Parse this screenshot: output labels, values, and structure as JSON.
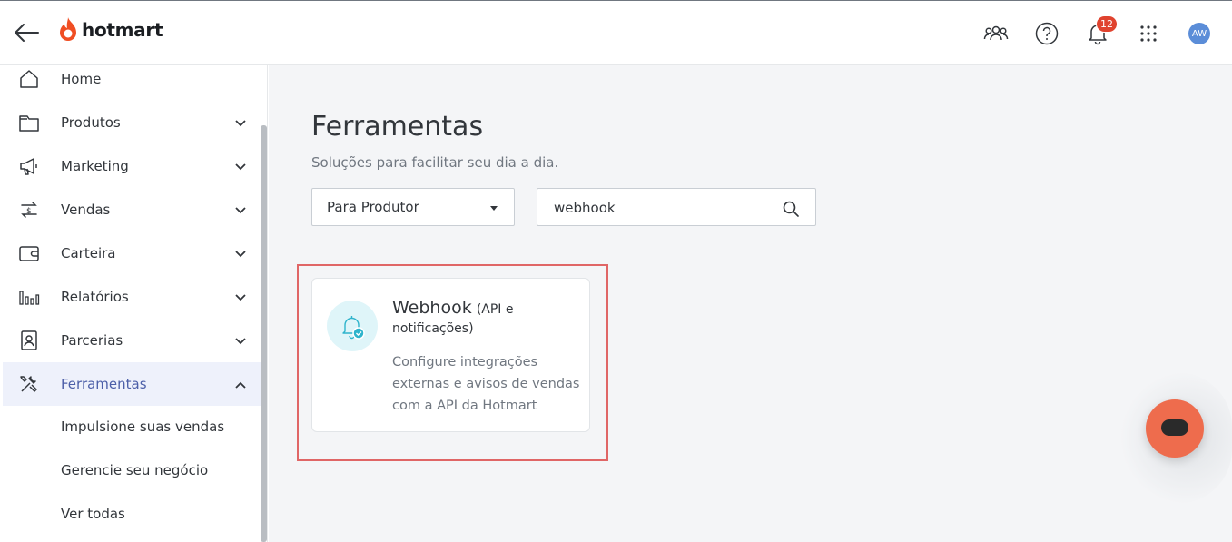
{
  "header": {
    "logo_text": "hotmart",
    "notifications_count": "12",
    "avatar_initials": "AW"
  },
  "sidebar": {
    "items": [
      {
        "label": "Home",
        "icon": "home-icon"
      },
      {
        "label": "Produtos",
        "icon": "folder-icon"
      },
      {
        "label": "Marketing",
        "icon": "megaphone-icon"
      },
      {
        "label": "Vendas",
        "icon": "exchange-dollar-icon"
      },
      {
        "label": "Carteira",
        "icon": "wallet-icon"
      },
      {
        "label": "Relatórios",
        "icon": "bar-chart-icon"
      },
      {
        "label": "Parcerias",
        "icon": "id-badge-icon"
      },
      {
        "label": "Ferramentas",
        "icon": "tools-icon"
      }
    ],
    "subitems": [
      "Impulsione suas vendas",
      "Gerencie seu negócio",
      "Ver todas"
    ]
  },
  "main": {
    "title": "Ferramentas",
    "subtitle": "Soluções para facilitar seu dia a dia.",
    "filter_selected": "Para Produtor",
    "search_value": "webhook",
    "card": {
      "title": "Webhook",
      "title_suffix": "(API e notificações)",
      "description": "Configure integrações externas e avisos de vendas com a API da Hotmart"
    }
  },
  "colors": {
    "brand_orange": "#f04e23",
    "active_nav_bg": "#eef1fb",
    "active_nav_text": "#4c5fa8",
    "highlight_border": "#e06666",
    "chat_button": "#ee6c4d",
    "badge": "#e0432f"
  }
}
